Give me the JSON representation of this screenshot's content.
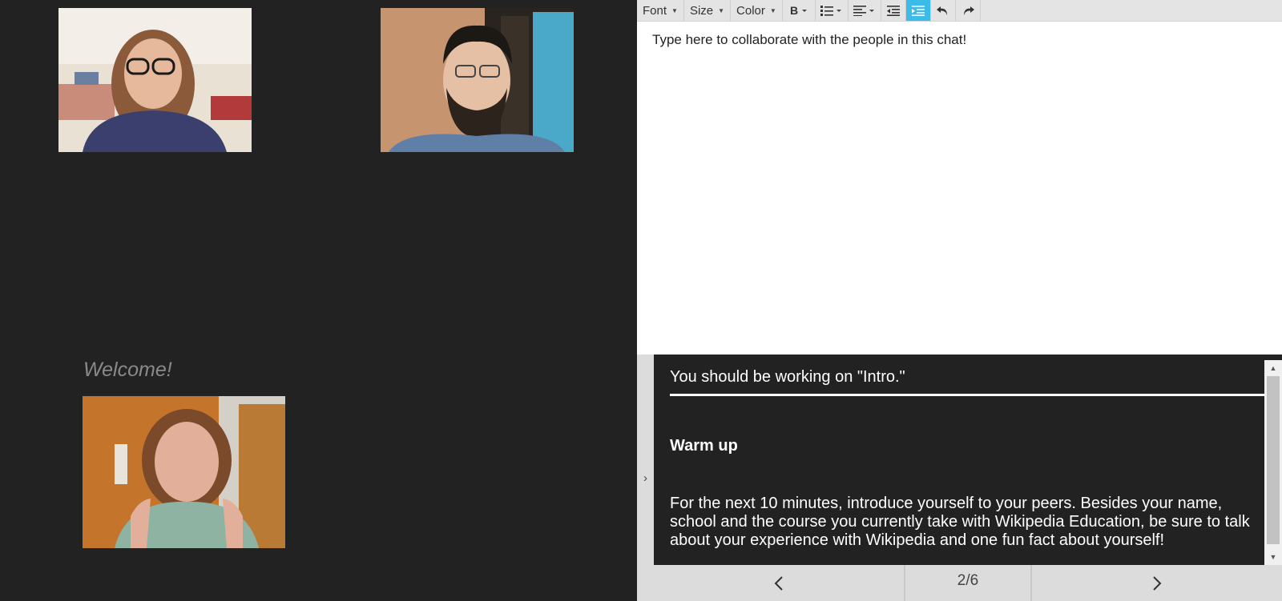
{
  "video": {
    "welcome_text": "Welcome!"
  },
  "editor": {
    "toolbar": {
      "font_label": "Font",
      "size_label": "Size",
      "color_label": "Color",
      "icons": [
        "bold-icon",
        "bullet-list-icon",
        "align-left-icon",
        "outdent-icon",
        "indent-icon",
        "undo-icon",
        "redo-icon"
      ],
      "active_color": "#3bbbe8"
    },
    "placeholder_text": "Type here to collaborate with the people in this chat!"
  },
  "task": {
    "status": "You should be working on \"Intro.\"",
    "heading": "Warm up",
    "body": "For the next 10 minutes, introduce yourself to your peers. Besides your name, school and the course you currently take with Wikipedia Education, be sure to talk about your experience with Wikipedia and one fun fact about yourself!"
  },
  "pager": {
    "count": "2/6"
  }
}
